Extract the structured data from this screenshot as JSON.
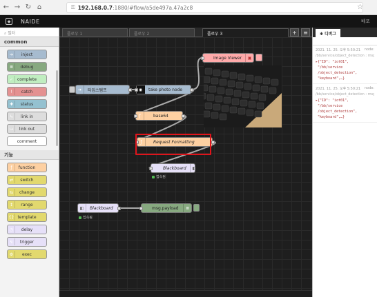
{
  "browser": {
    "url_host": "192.168.0.7",
    "url_path": ":1880/#flow/a5de497a.47a2c8"
  },
  "app": {
    "title": "NAIDE",
    "deploy_label": "배포"
  },
  "palette": {
    "filter_placeholder": "필터",
    "categories": [
      {
        "label": "common",
        "nodes": [
          {
            "label": "inject",
            "color": "#a6bbcf"
          },
          {
            "label": "debug",
            "color": "#87a980"
          },
          {
            "label": "complete",
            "color": "#c0edc0"
          },
          {
            "label": "catch",
            "color": "#e49191"
          },
          {
            "label": "status",
            "color": "#94c1d0"
          },
          {
            "label": "link in",
            "color": "#dddddd"
          },
          {
            "label": "link out",
            "color": "#dddddd"
          },
          {
            "label": "comment",
            "color": "#ffffff"
          }
        ]
      },
      {
        "label": "기능",
        "nodes": [
          {
            "label": "function",
            "color": "#fdd0a2"
          },
          {
            "label": "switch",
            "color": "#e2d96e"
          },
          {
            "label": "change",
            "color": "#e2d96e"
          },
          {
            "label": "range",
            "color": "#e2d96e"
          },
          {
            "label": "template",
            "color": "#e2d96e"
          },
          {
            "label": "delay",
            "color": "#e6e0f8"
          },
          {
            "label": "trigger",
            "color": "#e6e0f8"
          },
          {
            "label": "exec",
            "color": "#e2d96e"
          }
        ]
      }
    ]
  },
  "workspace": {
    "tabs": [
      "플로우 1",
      "플로우 2",
      "플로우 3"
    ],
    "active_tab": 2,
    "nodes": {
      "image_viewer": {
        "label": "Image Viewer",
        "color": "#ffaaaa"
      },
      "timestamp": {
        "label": "타임스탬프",
        "color": "#a6bbcf"
      },
      "take_photo": {
        "label": "take photo node",
        "color": "#a6bbcf"
      },
      "base64": {
        "label": "base64",
        "color": "#fdd0a2"
      },
      "request_formatting": {
        "label": "Request Formatting",
        "color": "#fdd0a2"
      },
      "blackboard1": {
        "label": "Blackboard",
        "color": "#e6e0f8",
        "status": "접속됨"
      },
      "blackboard2": {
        "label": "Blackboard",
        "color": "#e6e0f8",
        "status": "접속됨"
      },
      "msg_payload": {
        "label": "msg.payload",
        "color": "#87a980"
      }
    }
  },
  "sidebar": {
    "tab_label": "디버그",
    "messages": [
      {
        "timestamp": "2021. 11. 25. 오후 5:50:21",
        "source": "node:",
        "topic": "/bb/service/object_detection : msg.payload : Object",
        "body": "▸{\"ID\": \"iot01\",\n \"/bb/service\n /object_detection\",\n \"keyboard\",…}"
      },
      {
        "timestamp": "2021. 11. 25. 오후 5:50:21",
        "source": "node:",
        "topic": "/bb/service/object_detection : msg.payload : Object",
        "body": "▸{\"ID\": \"iot01\",\n \"/bb/service\n /object_detection\",\n \"keyboard\",…}"
      }
    ]
  },
  "colors": {
    "highlight": "#e0141b",
    "canvas": "#1e1e1e",
    "header": "#141414"
  }
}
